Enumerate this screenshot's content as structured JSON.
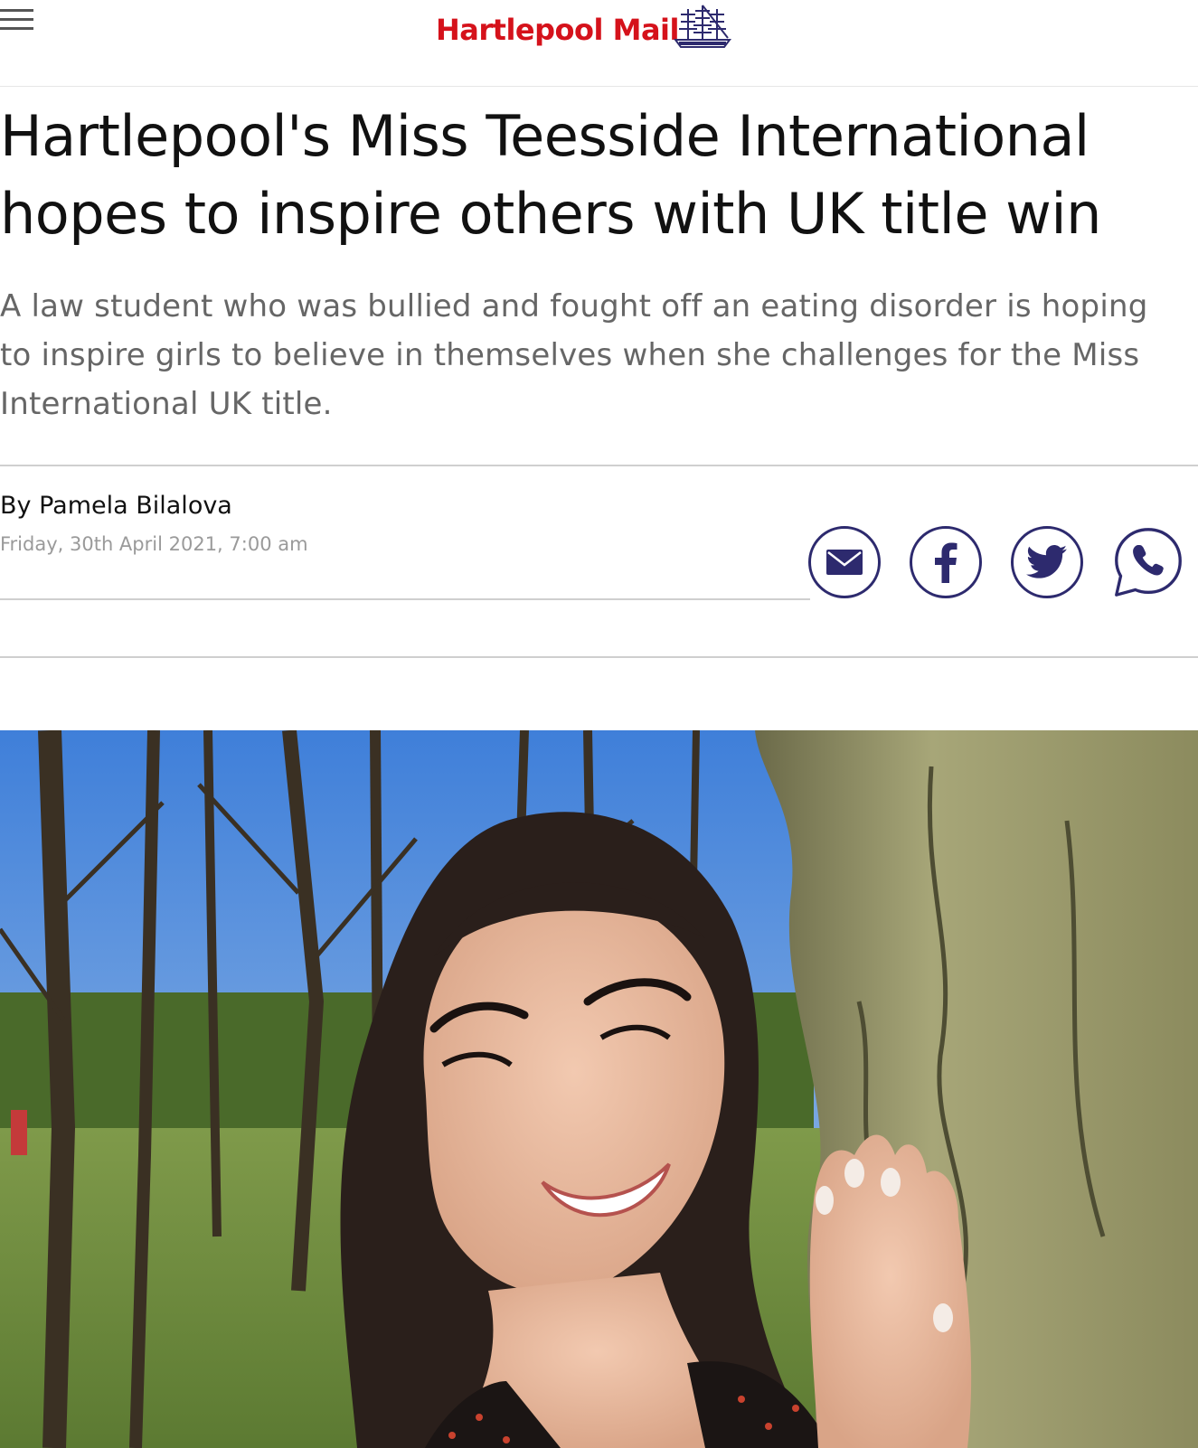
{
  "header": {
    "logo_text": "Hartlepool Mail",
    "menu_icon": "hamburger-menu-icon",
    "logo_icon": "sailing-ship-icon",
    "brand_color": "#d5121b",
    "icon_color": "#2d2a6e"
  },
  "article": {
    "headline": "Hartlepool's Miss Teesside International hopes to inspire others with UK title win",
    "standfirst": "A law student who was bullied and fought off an eating disorder is hoping to inspire girls to believe in themselves when she challenges for the Miss International UK title.",
    "byline": "By Pamela Bilalova",
    "date": "Friday, 30th April 2021, 7:00 am"
  },
  "share": {
    "icons": [
      "email-icon",
      "facebook-icon",
      "twitter-icon",
      "whatsapp-icon"
    ]
  }
}
